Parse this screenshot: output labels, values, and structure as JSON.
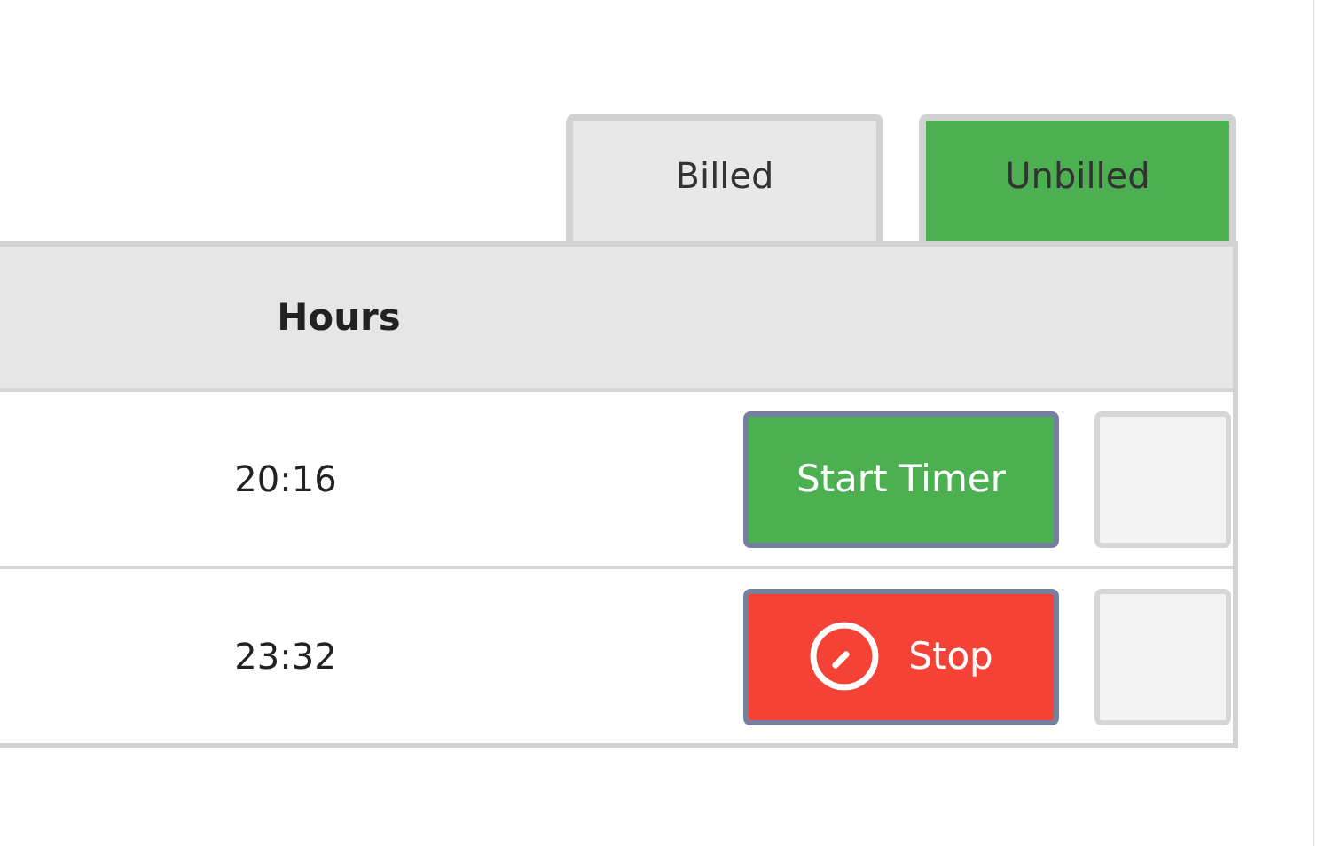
{
  "tabs": [
    {
      "label": "Billed",
      "selected": false
    },
    {
      "label": "Unbilled",
      "selected": true
    }
  ],
  "table": {
    "columns": [
      "Hours"
    ],
    "rows": [
      {
        "hours": "20:16",
        "timer": {
          "kind": "start",
          "label": "Start Timer"
        }
      },
      {
        "hours": "23:32",
        "timer": {
          "kind": "stop",
          "label": "Stop"
        }
      }
    ]
  }
}
